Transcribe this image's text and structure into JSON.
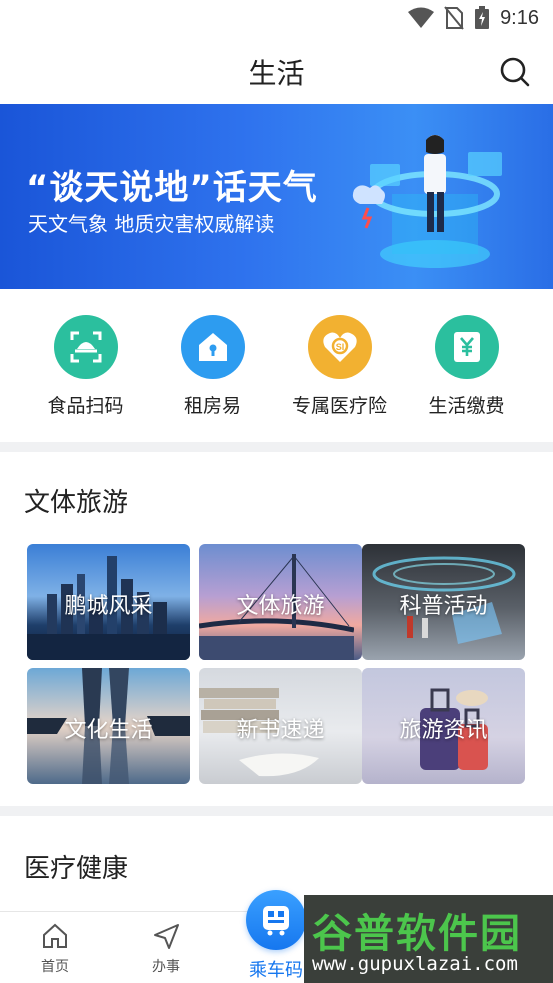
{
  "status_bar": {
    "time": "9:16"
  },
  "header": {
    "title": "生活"
  },
  "banner": {
    "title": "“谈天说地”话天气",
    "subtitle": "天文气象 地质灾害权威解读"
  },
  "services": [
    {
      "label": "食品扫码",
      "icon": "scan-food-icon",
      "color": "#2bbf9e"
    },
    {
      "label": "租房易",
      "icon": "house-icon",
      "color": "#2d9cf0"
    },
    {
      "label": "专属医疗险",
      "icon": "heart-shield-icon",
      "color": "#f2b131"
    },
    {
      "label": "生活缴费",
      "icon": "yen-bill-icon",
      "color": "#2bbf9e"
    }
  ],
  "culture_section": {
    "title": "文体旅游",
    "tiles": [
      {
        "label": "鹏城风采"
      },
      {
        "label": "文体旅游"
      },
      {
        "label": "科普活动"
      },
      {
        "label": "文化生活"
      },
      {
        "label": "新书速递"
      },
      {
        "label": "旅游资讯"
      }
    ]
  },
  "health_section": {
    "title": "医疗健康"
  },
  "bottom_nav": {
    "home": "首页",
    "affairs": "办事",
    "ride_code": "乘车码"
  },
  "watermark": {
    "big": "谷普软件园",
    "small": "www.gupuxlazai.com"
  },
  "colors": {
    "accent": "#1677ef",
    "banner": "#2f73ee",
    "teal": "#2bbf9e",
    "gold": "#f2b131"
  }
}
